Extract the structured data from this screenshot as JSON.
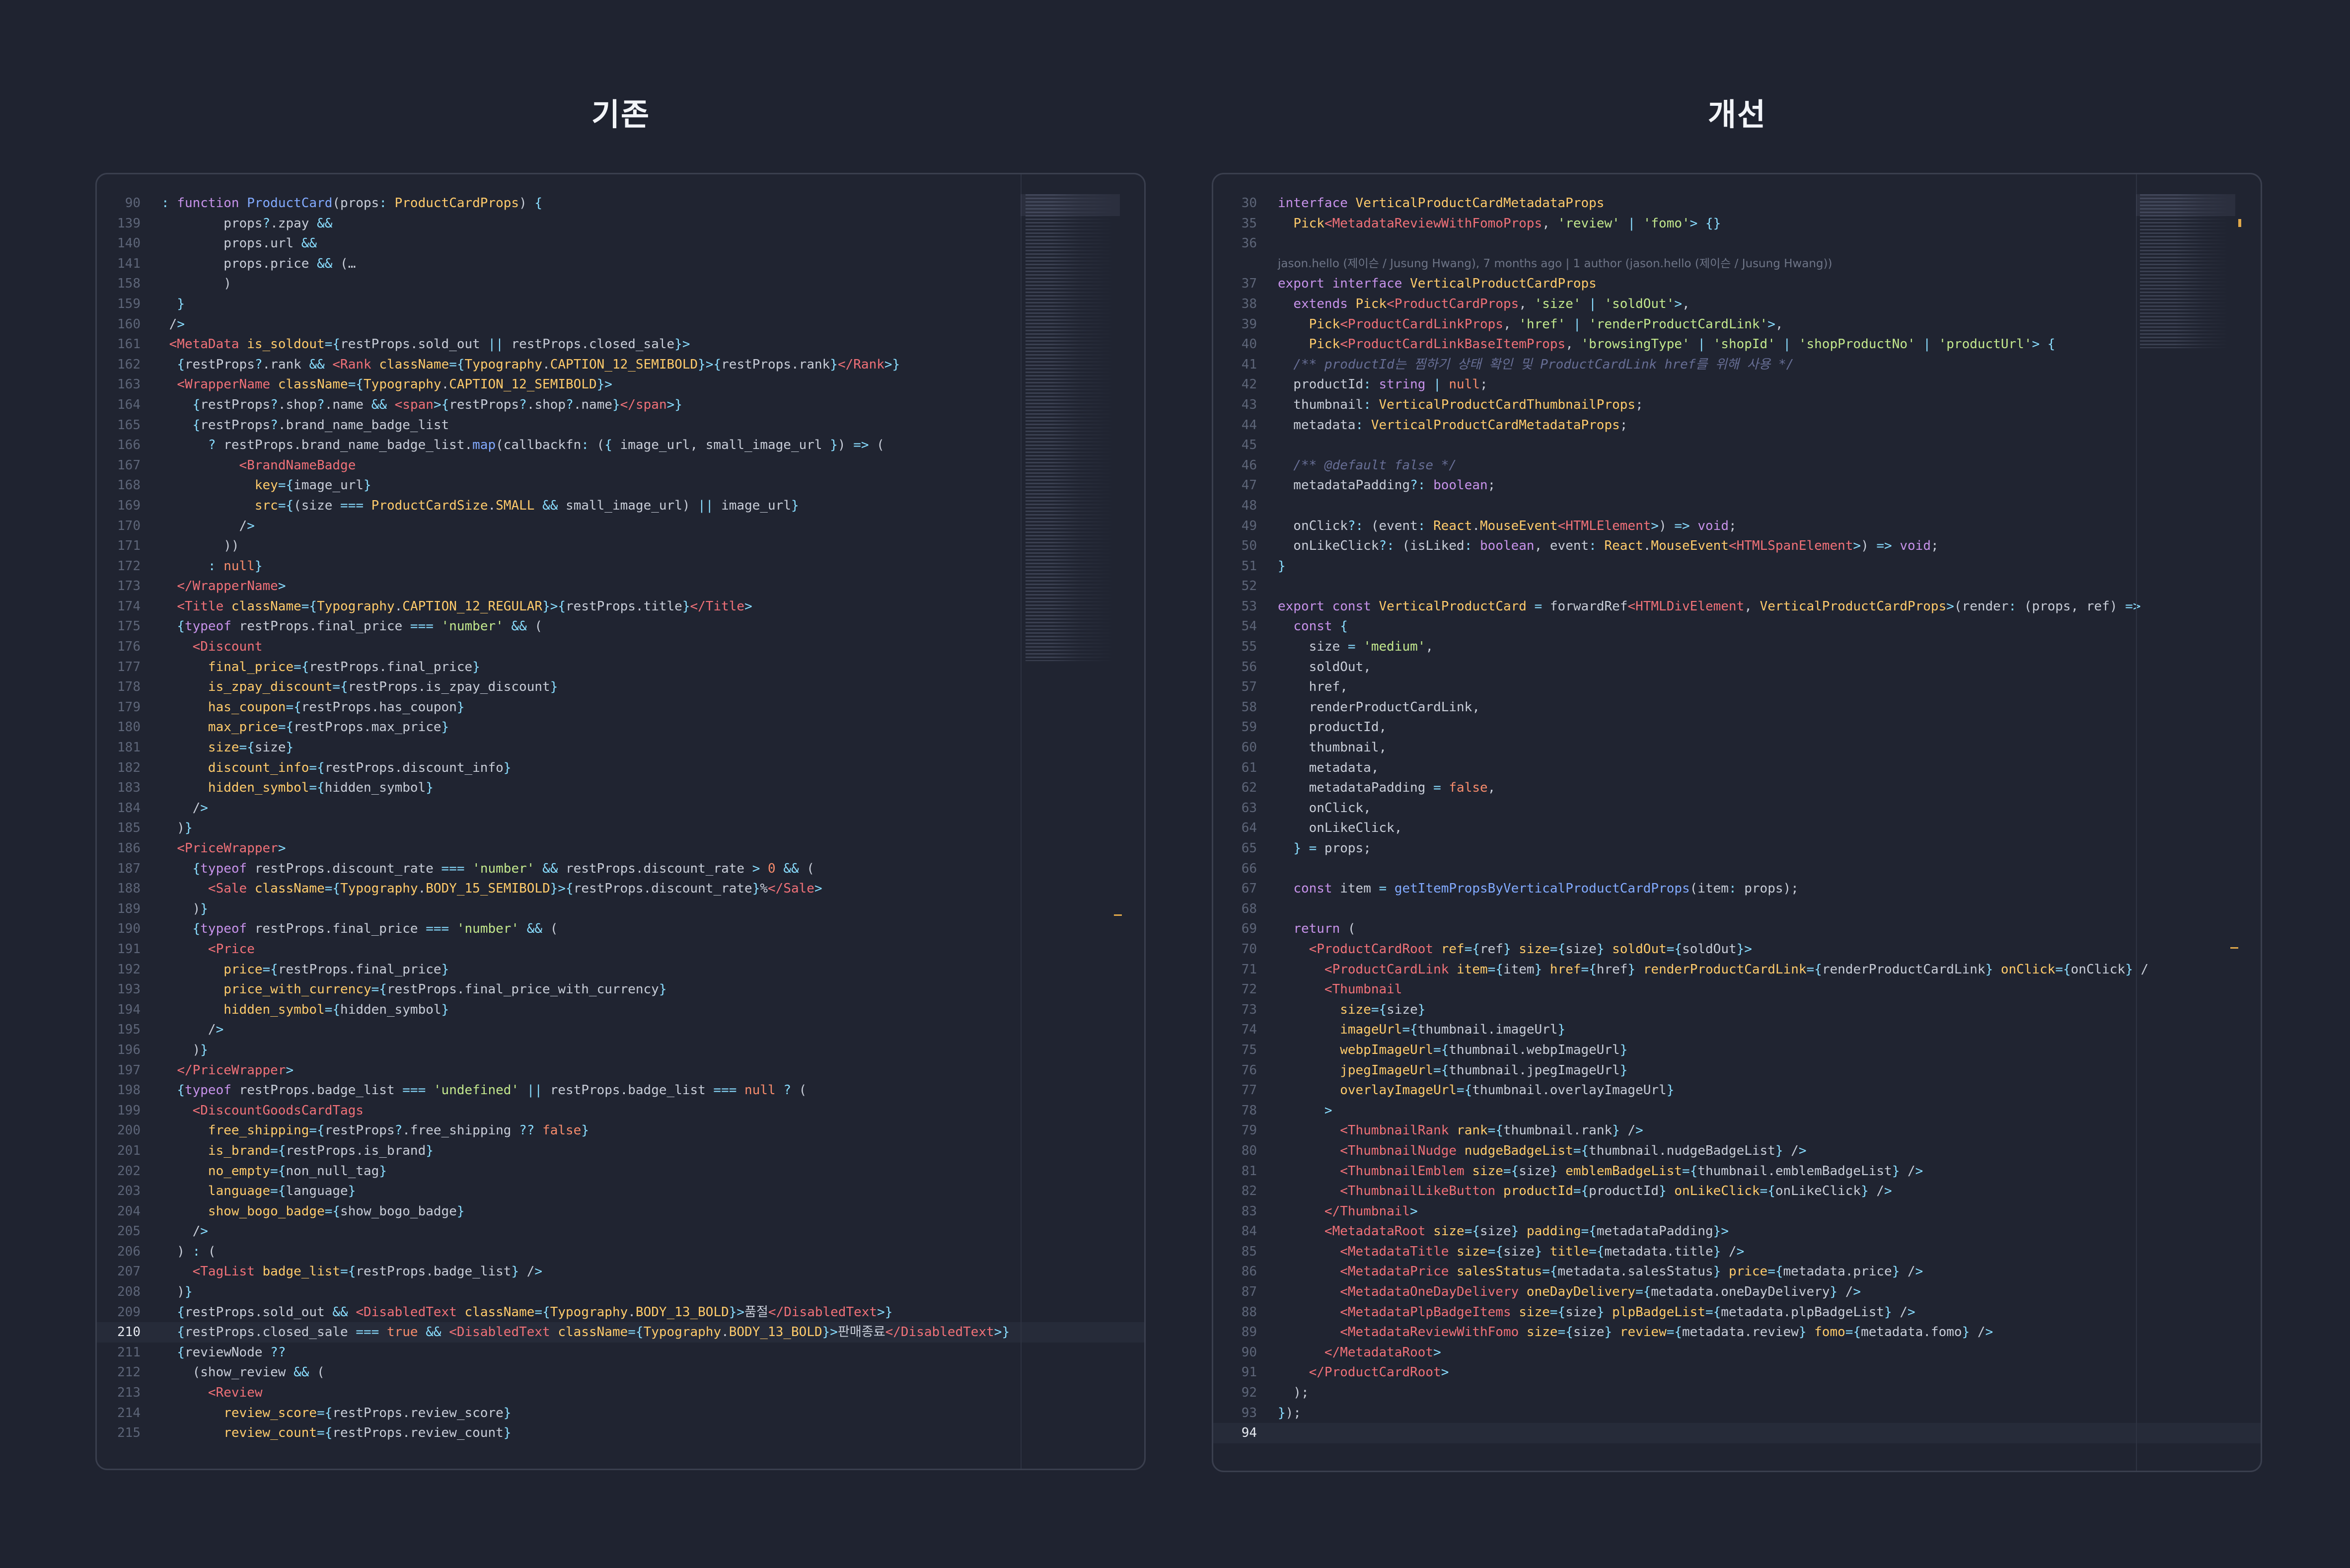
{
  "panels": {
    "left_title": "기존",
    "right_title": "개선"
  },
  "left_editor": {
    "active_line": "210",
    "lines": [
      {
        "n": "90",
        "t": ": function ProductCard(props: ProductCardProps) {"
      },
      {
        "n": "139",
        "t": "        props?.zpay &&"
      },
      {
        "n": "140",
        "t": "        props.url &&"
      },
      {
        "n": "141",
        "t": "        props.price && (…"
      },
      {
        "n": "158",
        "t": "        )"
      },
      {
        "n": "159",
        "t": "  }"
      },
      {
        "n": "160",
        "t": " />"
      },
      {
        "n": "161",
        "t": " <MetaData is_soldout={restProps.sold_out || restProps.closed_sale}>"
      },
      {
        "n": "162",
        "t": "  {restProps?.rank && <Rank className={Typography.CAPTION_12_SEMIBOLD}>{restProps.rank}</Rank>}"
      },
      {
        "n": "163",
        "t": "  <WrapperName className={Typography.CAPTION_12_SEMIBOLD}>"
      },
      {
        "n": "164",
        "t": "    {restProps?.shop?.name && <span>{restProps?.shop?.name}</span>}"
      },
      {
        "n": "165",
        "t": "    {restProps?.brand_name_badge_list"
      },
      {
        "n": "166",
        "t": "      ? restProps.brand_name_badge_list.map(callbackfn: ({ image_url, small_image_url }) => ("
      },
      {
        "n": "167",
        "t": "          <BrandNameBadge"
      },
      {
        "n": "168",
        "t": "            key={image_url}"
      },
      {
        "n": "169",
        "t": "            src={(size === ProductCardSize.SMALL && small_image_url) || image_url}"
      },
      {
        "n": "170",
        "t": "          />"
      },
      {
        "n": "171",
        "t": "        ))"
      },
      {
        "n": "172",
        "t": "      : null}"
      },
      {
        "n": "173",
        "t": "  </WrapperName>"
      },
      {
        "n": "174",
        "t": "  <Title className={Typography.CAPTION_12_REGULAR}>{restProps.title}</Title>"
      },
      {
        "n": "175",
        "t": "  {typeof restProps.final_price === 'number' && ("
      },
      {
        "n": "176",
        "t": "    <Discount"
      },
      {
        "n": "177",
        "t": "      final_price={restProps.final_price}"
      },
      {
        "n": "178",
        "t": "      is_zpay_discount={restProps.is_zpay_discount}"
      },
      {
        "n": "179",
        "t": "      has_coupon={restProps.has_coupon}"
      },
      {
        "n": "180",
        "t": "      max_price={restProps.max_price}"
      },
      {
        "n": "181",
        "t": "      size={size}"
      },
      {
        "n": "182",
        "t": "      discount_info={restProps.discount_info}"
      },
      {
        "n": "183",
        "t": "      hidden_symbol={hidden_symbol}"
      },
      {
        "n": "184",
        "t": "    />"
      },
      {
        "n": "185",
        "t": "  )}"
      },
      {
        "n": "186",
        "t": "  <PriceWrapper>"
      },
      {
        "n": "187",
        "t": "    {typeof restProps.discount_rate === 'number' && restProps.discount_rate > 0 && ("
      },
      {
        "n": "188",
        "t": "      <Sale className={Typography.BODY_15_SEMIBOLD}>{restProps.discount_rate}%</Sale>"
      },
      {
        "n": "189",
        "t": "    )}"
      },
      {
        "n": "190",
        "t": "    {typeof restProps.final_price === 'number' && ("
      },
      {
        "n": "191",
        "t": "      <Price"
      },
      {
        "n": "192",
        "t": "        price={restProps.final_price}"
      },
      {
        "n": "193",
        "t": "        price_with_currency={restProps.final_price_with_currency}"
      },
      {
        "n": "194",
        "t": "        hidden_symbol={hidden_symbol}"
      },
      {
        "n": "195",
        "t": "      />"
      },
      {
        "n": "196",
        "t": "    )}"
      },
      {
        "n": "197",
        "t": "  </PriceWrapper>"
      },
      {
        "n": "198",
        "t": "  {typeof restProps.badge_list === 'undefined' || restProps.badge_list === null ? ("
      },
      {
        "n": "199",
        "t": "    <DiscountGoodsCardTags"
      },
      {
        "n": "200",
        "t": "      free_shipping={restProps?.free_shipping ?? false}"
      },
      {
        "n": "201",
        "t": "      is_brand={restProps.is_brand}"
      },
      {
        "n": "202",
        "t": "      no_empty={non_null_tag}"
      },
      {
        "n": "203",
        "t": "      language={language}"
      },
      {
        "n": "204",
        "t": "      show_bogo_badge={show_bogo_badge}"
      },
      {
        "n": "205",
        "t": "    />"
      },
      {
        "n": "206",
        "t": "  ) : ("
      },
      {
        "n": "207",
        "t": "    <TagList badge_list={restProps.badge_list} />"
      },
      {
        "n": "208",
        "t": "  )}"
      },
      {
        "n": "209",
        "t": "  {restProps.sold_out && <DisabledText className={Typography.BODY_13_BOLD}>품절</DisabledText>}"
      },
      {
        "n": "210",
        "t": "  {restProps.closed_sale === true && <DisabledText className={Typography.BODY_13_BOLD}>판매종료</DisabledText>}"
      },
      {
        "n": "211",
        "t": "  {reviewNode ??"
      },
      {
        "n": "212",
        "t": "    (show_review && ("
      },
      {
        "n": "213",
        "t": "      <Review"
      },
      {
        "n": "214",
        "t": "        review_score={restProps.review_score}"
      },
      {
        "n": "215",
        "t": "        review_count={restProps.review_count}"
      }
    ]
  },
  "right_editor": {
    "active_line": "94",
    "blame": "jason.hello (제이슨 / Jusung Hwang), 7 months ago | 1 author (jason.hello (제이슨 / Jusung Hwang))",
    "lines": [
      {
        "n": "30",
        "t": "interface VerticalProductCardMetadataProps"
      },
      {
        "n": "35",
        "t": "  Pick<MetadataReviewWithFomoProps, 'review' | 'fomo'> {}"
      },
      {
        "n": "36",
        "t": ""
      },
      {
        "n": "",
        "t": "",
        "blame": true
      },
      {
        "n": "37",
        "t": "export interface VerticalProductCardProps"
      },
      {
        "n": "38",
        "t": "  extends Pick<ProductCardProps, 'size' | 'soldOut'>,"
      },
      {
        "n": "39",
        "t": "    Pick<ProductCardLinkProps, 'href' | 'renderProductCardLink'>,"
      },
      {
        "n": "40",
        "t": "    Pick<ProductCardLinkBaseItemProps, 'browsingType' | 'shopId' | 'shopProductNo' | 'productUrl'> {"
      },
      {
        "n": "41",
        "t": "  /** productId는 찜하기 상태 확인 및 ProductCardLink href를 위해 사용 */"
      },
      {
        "n": "42",
        "t": "  productId: string | null;"
      },
      {
        "n": "43",
        "t": "  thumbnail: VerticalProductCardThumbnailProps;"
      },
      {
        "n": "44",
        "t": "  metadata: VerticalProductCardMetadataProps;"
      },
      {
        "n": "45",
        "t": ""
      },
      {
        "n": "46",
        "t": "  /** @default false */"
      },
      {
        "n": "47",
        "t": "  metadataPadding?: boolean;"
      },
      {
        "n": "48",
        "t": ""
      },
      {
        "n": "49",
        "t": "  onClick?: (event: React.MouseEvent<HTMLElement>) => void;"
      },
      {
        "n": "50",
        "t": "  onLikeClick?: (isLiked: boolean, event: React.MouseEvent<HTMLSpanElement>) => void;"
      },
      {
        "n": "51",
        "t": "}"
      },
      {
        "n": "52",
        "t": ""
      },
      {
        "n": "53",
        "t": "export const VerticalProductCard = forwardRef<HTMLDivElement, VerticalProductCardProps>(render: (props, ref) =>"
      },
      {
        "n": "54",
        "t": "  const {"
      },
      {
        "n": "55",
        "t": "    size = 'medium',"
      },
      {
        "n": "56",
        "t": "    soldOut,"
      },
      {
        "n": "57",
        "t": "    href,"
      },
      {
        "n": "58",
        "t": "    renderProductCardLink,"
      },
      {
        "n": "59",
        "t": "    productId,"
      },
      {
        "n": "60",
        "t": "    thumbnail,"
      },
      {
        "n": "61",
        "t": "    metadata,"
      },
      {
        "n": "62",
        "t": "    metadataPadding = false,"
      },
      {
        "n": "63",
        "t": "    onClick,"
      },
      {
        "n": "64",
        "t": "    onLikeClick,"
      },
      {
        "n": "65",
        "t": "  } = props;"
      },
      {
        "n": "66",
        "t": ""
      },
      {
        "n": "67",
        "t": "  const item = getItemPropsByVerticalProductCardProps(item: props);"
      },
      {
        "n": "68",
        "t": ""
      },
      {
        "n": "69",
        "t": "  return ("
      },
      {
        "n": "70",
        "t": "    <ProductCardRoot ref={ref} size={size} soldOut={soldOut}>"
      },
      {
        "n": "71",
        "t": "      <ProductCardLink item={item} href={href} renderProductCardLink={renderProductCardLink} onClick={onClick} /"
      },
      {
        "n": "72",
        "t": "      <Thumbnail"
      },
      {
        "n": "73",
        "t": "        size={size}"
      },
      {
        "n": "74",
        "t": "        imageUrl={thumbnail.imageUrl}"
      },
      {
        "n": "75",
        "t": "        webpImageUrl={thumbnail.webpImageUrl}"
      },
      {
        "n": "76",
        "t": "        jpegImageUrl={thumbnail.jpegImageUrl}"
      },
      {
        "n": "77",
        "t": "        overlayImageUrl={thumbnail.overlayImageUrl}"
      },
      {
        "n": "78",
        "t": "      >"
      },
      {
        "n": "79",
        "t": "        <ThumbnailRank rank={thumbnail.rank} />"
      },
      {
        "n": "80",
        "t": "        <ThumbnailNudge nudgeBadgeList={thumbnail.nudgeBadgeList} />"
      },
      {
        "n": "81",
        "t": "        <ThumbnailEmblem size={size} emblemBadgeList={thumbnail.emblemBadgeList} />"
      },
      {
        "n": "82",
        "t": "        <ThumbnailLikeButton productId={productId} onLikeClick={onLikeClick} />"
      },
      {
        "n": "83",
        "t": "      </Thumbnail>"
      },
      {
        "n": "84",
        "t": "      <MetadataRoot size={size} padding={metadataPadding}>"
      },
      {
        "n": "85",
        "t": "        <MetadataTitle size={size} title={metadata.title} />"
      },
      {
        "n": "86",
        "t": "        <MetadataPrice salesStatus={metadata.salesStatus} price={metadata.price} />"
      },
      {
        "n": "87",
        "t": "        <MetadataOneDayDelivery oneDayDelivery={metadata.oneDayDelivery} />"
      },
      {
        "n": "88",
        "t": "        <MetadataPlpBadgeItems size={size} plpBadgeList={metadata.plpBadgeList} />"
      },
      {
        "n": "89",
        "t": "        <MetadataReviewWithFomo size={size} review={metadata.review} fomo={metadata.fomo} />"
      },
      {
        "n": "90",
        "t": "      </MetadataRoot>"
      },
      {
        "n": "91",
        "t": "    </ProductCardRoot>"
      },
      {
        "n": "92",
        "t": "  );"
      },
      {
        "n": "93",
        "t": "});"
      },
      {
        "n": "94",
        "t": ""
      }
    ]
  },
  "colors": {
    "background": "#1f2330",
    "editor_bg": "#202431",
    "text": "#c8cdd8",
    "line_number": "#5d6578",
    "keyword": "#c792ea",
    "function": "#82aaff",
    "tag": "#f07178",
    "string": "#c3e88d",
    "comment": "#676e95",
    "literal": "#f78c6c",
    "highlight": "#e0a84a"
  }
}
